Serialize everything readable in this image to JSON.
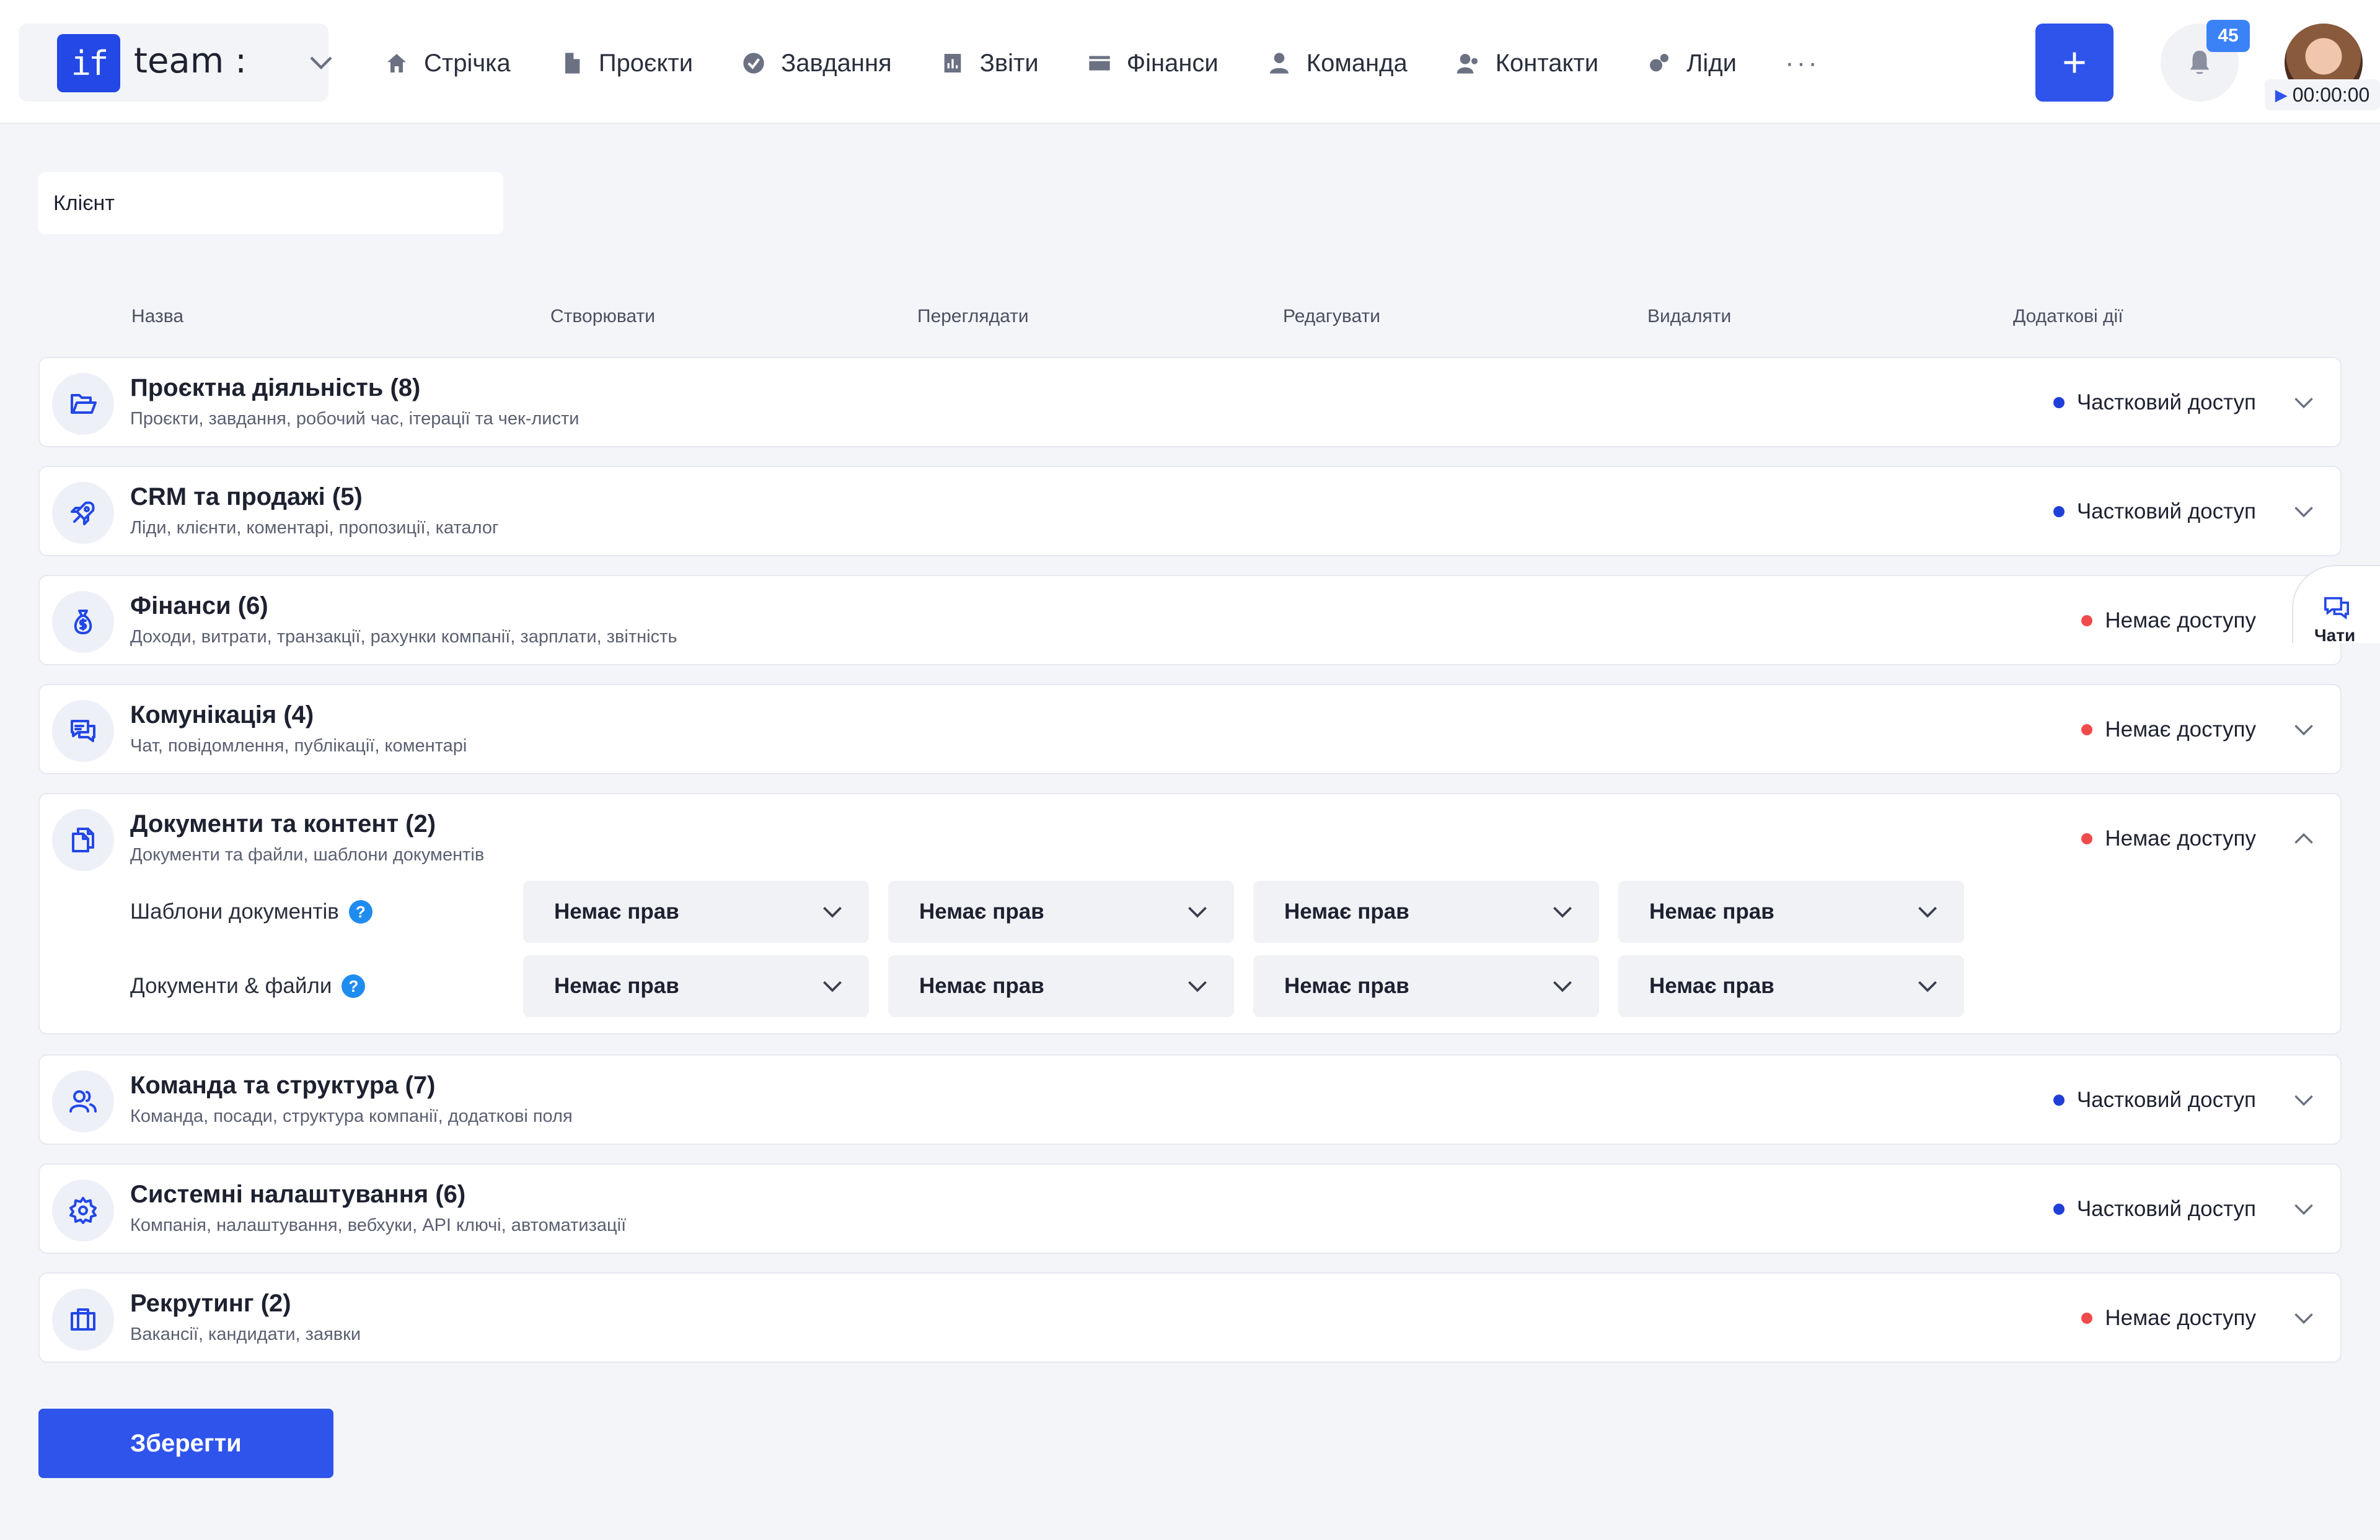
{
  "workspace": {
    "logo": "if",
    "name": "team :"
  },
  "nav": [
    {
      "label": "Стрічка",
      "icon": "home-icon"
    },
    {
      "label": "Проєкти",
      "icon": "file-icon"
    },
    {
      "label": "Завдання",
      "icon": "check-circle-icon"
    },
    {
      "label": "Звіти",
      "icon": "report-icon"
    },
    {
      "label": "Фінанси",
      "icon": "wallet-icon"
    },
    {
      "label": "Команда",
      "icon": "user-icon"
    },
    {
      "label": "Контакти",
      "icon": "contacts-icon"
    },
    {
      "label": "Ліди",
      "icon": "leads-icon"
    }
  ],
  "nav_more": "···",
  "header": {
    "add": "+",
    "notifications_count": "45",
    "timer": "00:00:00"
  },
  "role_name": "Клієнт",
  "columns": [
    "Назва",
    "Створювати",
    "Переглядати",
    "Редагувати",
    "Видаляти",
    "Додаткові дії"
  ],
  "sections": [
    {
      "title": "Проєктна діяльність (8)",
      "subtitle": "Проєкти, завдання, робочий час, ітерації та чек-листи",
      "status": "Частковий доступ",
      "status_kind": "partial",
      "icon": "folder-open-icon"
    },
    {
      "title": "CRM та продажі (5)",
      "subtitle": "Ліди, клієнти, коментарі, пропозиції, каталог",
      "status": "Частковий доступ",
      "status_kind": "partial",
      "icon": "rocket-icon"
    },
    {
      "title": "Фінанси (6)",
      "subtitle": "Доходи, витрати, транзакції, рахунки компанії, зарплати, звітність",
      "status": "Немає доступу",
      "status_kind": "none",
      "icon": "money-bag-icon"
    },
    {
      "title": "Комунікація (4)",
      "subtitle": "Чат, повідомлення, публікації, коментарі",
      "status": "Немає доступу",
      "status_kind": "none",
      "icon": "chat-bubbles-icon"
    },
    {
      "title": "Документи та контент (2)",
      "subtitle": "Документи та файли, шаблони документів",
      "status": "Немає доступу",
      "status_kind": "none",
      "icon": "documents-icon",
      "expanded": true
    },
    {
      "title": "Команда та структура (7)",
      "subtitle": "Команда, посади, структура компанії, додаткові поля",
      "status": "Частковий доступ",
      "status_kind": "partial",
      "icon": "team-icon"
    },
    {
      "title": "Системні налаштування (6)",
      "subtitle": "Компанія, налаштування, вебхуки, API ключі, автоматизації",
      "status": "Частковий доступ",
      "status_kind": "partial",
      "icon": "gear-icon"
    },
    {
      "title": "Рекрутинг (2)",
      "subtitle": "Вакансії, кандидати, заявки",
      "status": "Немає доступу",
      "status_kind": "none",
      "icon": "briefcase-icon"
    }
  ],
  "expanded_rows": [
    {
      "label": "Шаблони документів",
      "help": "?",
      "values": [
        "Немає прав",
        "Немає прав",
        "Немає прав",
        "Немає прав"
      ]
    },
    {
      "label": "Документи & файли",
      "help": "?",
      "values": [
        "Немає прав",
        "Немає прав",
        "Немає прав",
        "Немає прав"
      ]
    }
  ],
  "save_label": "Зберегти",
  "chats_label": "Чати",
  "colors": {
    "accent": "#2f54eb",
    "partial": "#1f3fd8",
    "none": "#f04b4b"
  }
}
